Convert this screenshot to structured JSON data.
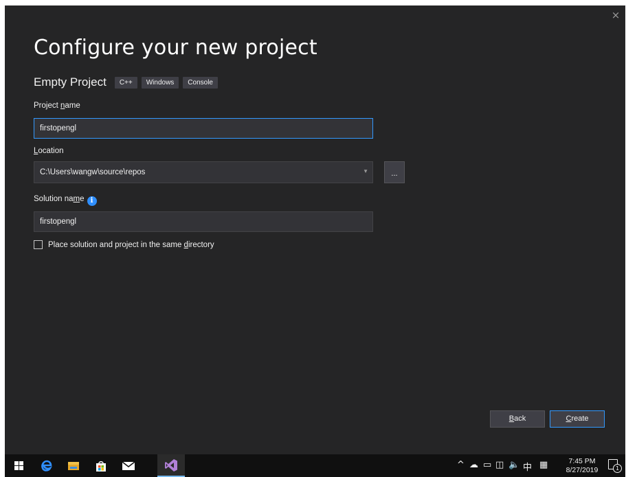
{
  "dialog": {
    "title": "Configure your new project",
    "close_glyph": "×",
    "template_name": "Empty Project",
    "tags": [
      "C++",
      "Windows",
      "Console"
    ],
    "project_name": {
      "label": "Project name",
      "value": "firstopengl"
    },
    "location": {
      "label": "Location",
      "value": "C:\\Users\\wangw\\source\\repos",
      "browse_label": "..."
    },
    "solution_name": {
      "label": "Solution name",
      "value": "firstopengl"
    },
    "same_directory_checkbox": {
      "label": "Place solution and project in the same directory",
      "checked": false
    },
    "back_label": "Back",
    "create_label": "Create"
  },
  "taskbar": {
    "apps": [
      "windows-start",
      "edge",
      "file-explorer",
      "store",
      "mail",
      "visual-studio"
    ],
    "tray": {
      "ime": "中",
      "time": "7:45 PM",
      "date": "8/27/2019",
      "notification_count": "1"
    }
  },
  "colors": {
    "dialog_bg": "#252526",
    "field_bg": "#333337",
    "focus_border": "#3399ff",
    "taskbar_bg": "#101010"
  }
}
